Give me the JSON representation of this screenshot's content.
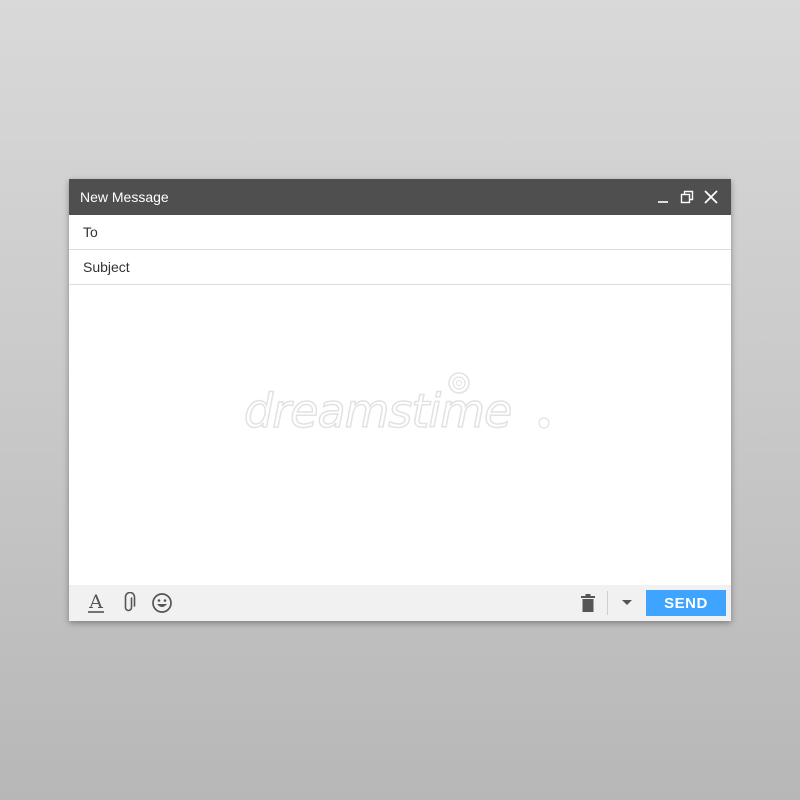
{
  "window": {
    "title": "New Message",
    "controls": [
      "minimize-icon",
      "restore-icon",
      "close-icon"
    ]
  },
  "fields": {
    "to_placeholder": "To",
    "to_value": "",
    "subject_placeholder": "Subject",
    "subject_value": ""
  },
  "body": {
    "value": ""
  },
  "watermark": {
    "text": "dreamstime"
  },
  "toolbar": {
    "icons": [
      "text-format-icon",
      "attachment-icon",
      "emoji-icon",
      "trash-icon",
      "chevron-down-icon"
    ],
    "send_label": "SEND"
  },
  "colors": {
    "titlebar": "#4f4f4f",
    "send_button": "#3ea4ff",
    "toolbar_bg": "#f1f1f1"
  }
}
